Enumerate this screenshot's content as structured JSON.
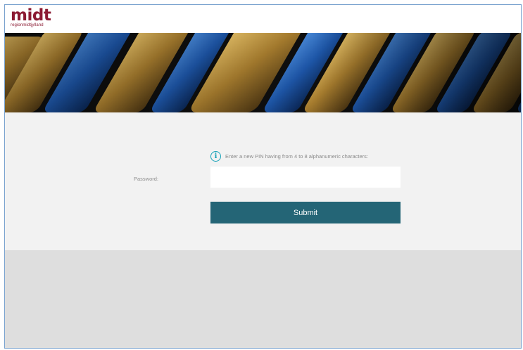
{
  "brand": {
    "logo_main": "midt",
    "logo_sub": "regionmidtjylland",
    "color": "#8b1a32"
  },
  "banner": {
    "icon": "keyboard-keys-image"
  },
  "form": {
    "hint_icon": "info-icon",
    "hint_text": "Enter a new PIN having from 4 to 8 alphanumeric characters:",
    "password_label": "Password:",
    "password_value": "",
    "password_placeholder": "",
    "submit_label": "Submit",
    "accent_color": "#246576",
    "info_color": "#17a2b8"
  }
}
